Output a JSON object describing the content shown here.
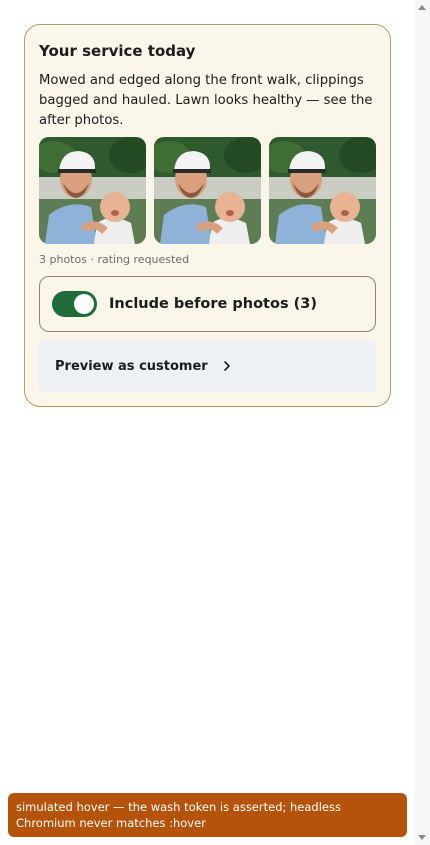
{
  "card": {
    "title": "Your service today",
    "body": "Mowed and edged along the front walk, clippings bagged and hauled. Lawn looks healthy — see the after photos.",
    "photos": [
      {
        "icon": "photo-thumbnail"
      },
      {
        "icon": "photo-thumbnail"
      },
      {
        "icon": "photo-thumbnail"
      }
    ],
    "photo_meta": "3 photos · rating requested",
    "toggle": {
      "label": "Include before photos (3)",
      "on": true
    },
    "preview": {
      "label": "Preview as customer",
      "icon": "chevron-right-icon"
    }
  },
  "toast": {
    "text": "simulated hover — the wash token is asserted; headless Chromium never matches :hover"
  },
  "colors": {
    "card_bg": "#fbf6ea",
    "card_border": "#b39a6a",
    "toggle_on": "#1f6b3a",
    "preview_bg": "#eef1f3",
    "toast_bg": "#b45309"
  }
}
